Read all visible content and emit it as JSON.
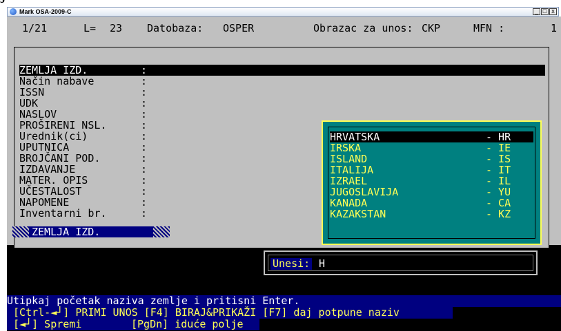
{
  "window": {
    "title": "Mark OSA-2009-C",
    "minimize_label": "_",
    "maximize_label": "□",
    "close_label": "x"
  },
  "status": {
    "record_position": "1/21",
    "length_label": "L=",
    "length_value": "23",
    "database_label": "Datobaza:",
    "database_value": "OSPER",
    "form_label": "Obrazac za unos:",
    "form_value": "CKP",
    "mfn_label": "MFN :",
    "mfn_value": "1"
  },
  "fields": [
    {
      "label": "ZEMLJA IZD.",
      "colon": ":"
    },
    {
      "label": "Način nabave",
      "colon": ":"
    },
    {
      "label": "ISSN",
      "colon": ":"
    },
    {
      "label": "UDK",
      "colon": ":"
    },
    {
      "label": "NASLOV",
      "colon": ":"
    },
    {
      "label": "PROŠIRENI NSL.",
      "colon": ":"
    },
    {
      "label": "Urednik(ci)",
      "colon": ":"
    },
    {
      "label": "UPUTNICA",
      "colon": ":"
    },
    {
      "label": "BROJČANI POD.",
      "colon": ":"
    },
    {
      "label": "IZDAVANJE",
      "colon": ":"
    },
    {
      "label": "MATER. OPIS",
      "colon": ":"
    },
    {
      "label": "UČESTALOST",
      "colon": ":"
    },
    {
      "label": "NAPOMENE",
      "colon": ":"
    },
    {
      "label": "Inventarni br.",
      "colon": ":"
    }
  ],
  "current_field": "ZEMLJA IZD.",
  "country_list": [
    {
      "name": "HRVATSKA",
      "code": "- HR"
    },
    {
      "name": "IRSKA",
      "code": "- IE"
    },
    {
      "name": "ISLAND",
      "code": "- IS"
    },
    {
      "name": "ITALIJA",
      "code": "- IT"
    },
    {
      "name": "IZRAEL",
      "code": "- IL"
    },
    {
      "name": "JUGOSLAVIJA",
      "code": "- YU"
    },
    {
      "name": "KANADA",
      "code": "- CA"
    },
    {
      "name": "KAZAKSTAN",
      "code": "- KZ"
    }
  ],
  "entry": {
    "label": "Unesi:",
    "value": "H"
  },
  "help": {
    "line1": "Utipkaj početak naziva zemlje i pritisni Enter.",
    "line2": " [Ctrl-◄┘] PRIMI UNOS [F4] BIRAJ&PRIKAŽI [F7] daj potpune naziv",
    "line3_a": " [◄┘] Spremi",
    "line3_b": "[PgDn] iduće polje"
  },
  "colors": {
    "console_bg": "#000000",
    "panel_gray": "#c0c0c0",
    "popup_teal": "#008080",
    "highlight_yellow": "#ffff55",
    "help_blue": "#000080"
  },
  "icons": {
    "app": "app-icon",
    "minimize": "minimize-icon",
    "maximize": "maximize-icon",
    "close": "close-icon"
  }
}
